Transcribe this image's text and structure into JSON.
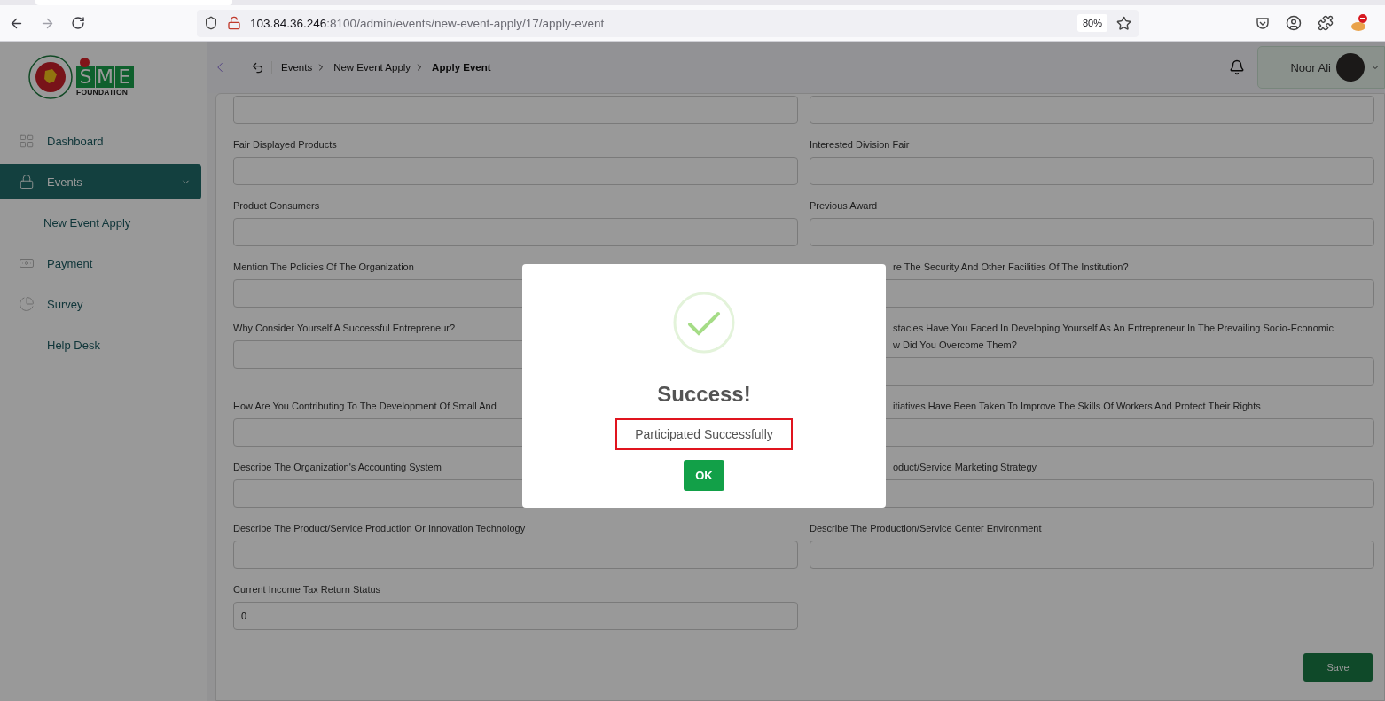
{
  "browser": {
    "url_host": "103.84.36.246",
    "url_rest": ":8100/admin/events/new-event-apply/17/apply-event",
    "zoom": "80%"
  },
  "logo": {
    "letters": "SME",
    "subtitle": "FOUNDATION"
  },
  "sidebar": {
    "items": [
      {
        "label": "Dashboard",
        "kind": "grid",
        "selected": false
      },
      {
        "label": "Events",
        "kind": "lock",
        "selected": true,
        "expanded": true,
        "children": [
          {
            "label": "New Event Apply",
            "selected": false
          }
        ]
      },
      {
        "label": "Payment",
        "kind": "money",
        "selected": false
      },
      {
        "label": "Survey",
        "kind": "pie",
        "selected": false
      },
      {
        "label": "Help Desk",
        "kind": "plain",
        "selected": false
      }
    ]
  },
  "breadcrumb": [
    {
      "label": "Events",
      "current": false
    },
    {
      "label": "New Event Apply",
      "current": false
    },
    {
      "label": "Apply Event",
      "current": true
    }
  ],
  "user": {
    "name": "Noor Ali"
  },
  "form": {
    "rows": [
      [
        {},
        {}
      ],
      [
        {
          "lines": [
            "Fair Displayed Products"
          ]
        },
        {
          "lines": [
            "Interested Division Fair"
          ]
        }
      ],
      [
        {
          "lines": [
            "Product Consumers"
          ]
        },
        {
          "lines": [
            "Previous Award"
          ]
        }
      ],
      [
        {
          "lines": [
            "Mention The Policies Of The Organization"
          ]
        },
        {
          "lines": [
            "re The Security And Other Facilities Of The Institution?"
          ],
          "covered": true
        }
      ],
      [
        {
          "lines": [
            "Why Consider Yourself A Successful Entrepreneur?"
          ]
        },
        {
          "lines": [
            "stacles Have You Faced In Developing Yourself As An Entrepreneur In The Prevailing Socio-Economic",
            "w Did You Overcome Them?"
          ],
          "covered": true
        }
      ],
      [
        {
          "lines": [
            "How Are You Contributing To The Development Of Small And"
          ]
        },
        {
          "lines": [
            "itiatives Have Been Taken To Improve The Skills Of Workers And Protect Their Rights"
          ],
          "covered": true
        }
      ],
      [
        {
          "lines": [
            "Describe The Organization's Accounting System"
          ]
        },
        {
          "lines": [
            "oduct/Service Marketing Strategy"
          ],
          "covered": true
        }
      ],
      [
        {
          "lines": [
            "Describe The Product/Service Production Or Innovation Technology"
          ]
        },
        {
          "lines": [
            "Describe The Production/Service Center Environment"
          ]
        }
      ],
      [
        {
          "lines": [
            "Current Income Tax Return Status"
          ],
          "value": "0"
        }
      ]
    ],
    "save_button": "Save"
  },
  "modal": {
    "title": "Success!",
    "message": "Participated Successfully",
    "button": "OK"
  }
}
